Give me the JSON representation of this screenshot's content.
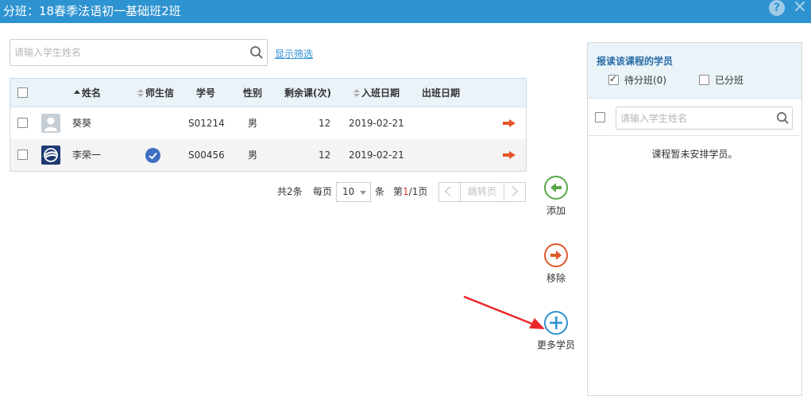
{
  "window": {
    "title": "分班：18春季法语初一基础班2班",
    "help_glyph": "?",
    "close_glyph": "✕"
  },
  "search": {
    "placeholder": "请输入学生姓名",
    "filter_link": "显示筛选"
  },
  "table": {
    "columns": [
      "姓名",
      "师生信",
      "学号",
      "性别",
      "剩余课(次)",
      "入班日期",
      "出班日期"
    ],
    "rows": [
      {
        "name": "葵葵",
        "linked": false,
        "student_id": "S01214",
        "gender": "男",
        "remaining": "12",
        "join_date": "2019-02-21",
        "leave_date": ""
      },
      {
        "name": "李荣一",
        "linked": true,
        "student_id": "S00456",
        "gender": "男",
        "remaining": "12",
        "join_date": "2019-02-21",
        "leave_date": ""
      }
    ]
  },
  "pager": {
    "total": "共2条",
    "per_page_label": "每页",
    "per_page_value": "10",
    "unit": "条",
    "page_prefix": "第",
    "current_page": "1",
    "page_suffix": "/1页",
    "jump_label": "跳转页"
  },
  "actions": {
    "add": "添加",
    "remove": "移除",
    "more": "更多学员"
  },
  "right_panel": {
    "title": "报读该课程的学员",
    "option_unassigned": "待分班(0)",
    "option_unassigned_checked": true,
    "option_assigned": "已分班",
    "option_assigned_checked": false,
    "search_placeholder": "请输入学生姓名",
    "empty_text": "课程暂未安排学员。"
  },
  "colors": {
    "titlebar": "#2e93d1",
    "link": "#2a8fd6",
    "add": "#5ba84a",
    "remove": "#de5a2c",
    "more": "#2e93d1",
    "annotation_arrow": "#e8282b"
  }
}
